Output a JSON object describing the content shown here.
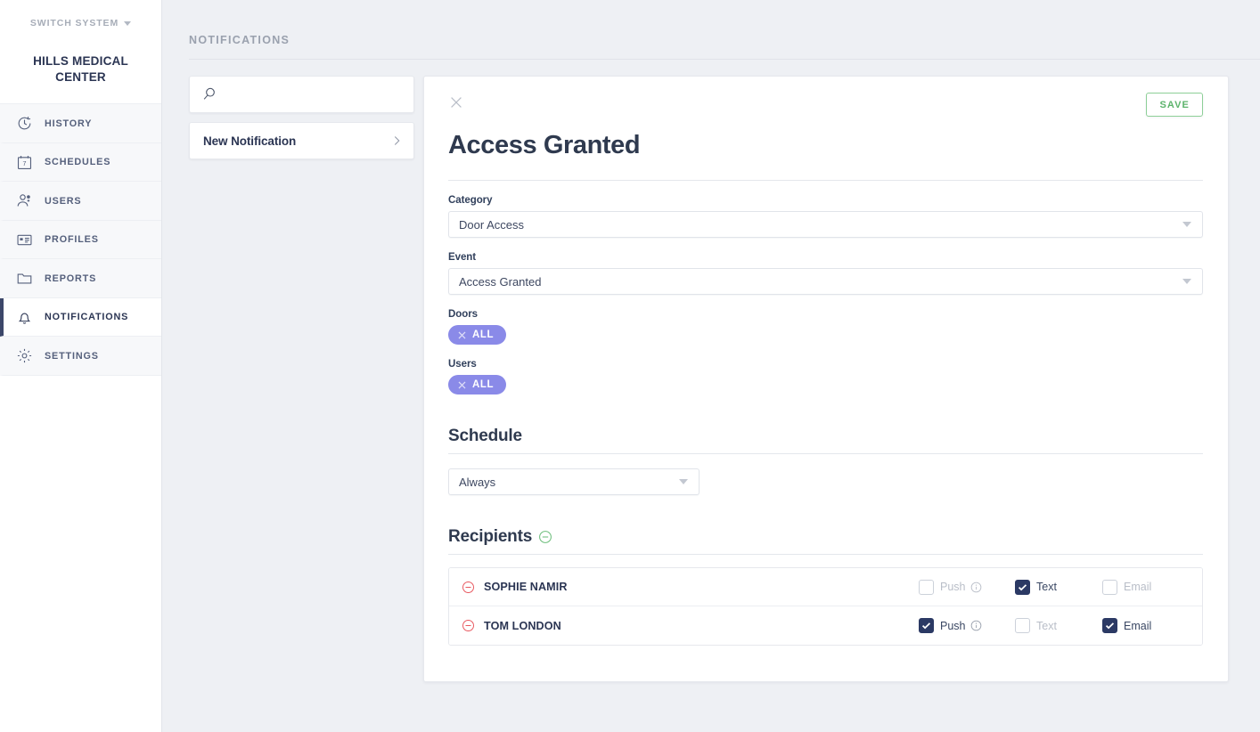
{
  "sidebar": {
    "switch_system": "SWITCH SYSTEM",
    "org_name": "HILLS MEDICAL CENTER",
    "items": [
      {
        "label": "HISTORY",
        "icon": "clock-icon",
        "active": false
      },
      {
        "label": "SCHEDULES",
        "icon": "calendar-icon",
        "active": false
      },
      {
        "label": "USERS",
        "icon": "users-icon",
        "active": false
      },
      {
        "label": "PROFILES",
        "icon": "id-card-icon",
        "active": false
      },
      {
        "label": "REPORTS",
        "icon": "folder-icon",
        "active": false
      },
      {
        "label": "NOTIFICATIONS",
        "icon": "bell-icon",
        "active": true
      },
      {
        "label": "SETTINGS",
        "icon": "gear-icon",
        "active": false
      }
    ]
  },
  "header": {
    "title": "NOTIFICATIONS"
  },
  "list_panel": {
    "search_placeholder": "",
    "search_value": "",
    "items": [
      {
        "label": "New Notification"
      }
    ]
  },
  "detail": {
    "close_label": "",
    "save_label": "SAVE",
    "title": "Access Granted",
    "fields": [
      {
        "label": "Category",
        "value": "Door Access"
      },
      {
        "label": "Event",
        "value": "Access Granted"
      }
    ],
    "doors": {
      "label": "Doors",
      "chip": "ALL"
    },
    "users": {
      "label": "Users",
      "chip": "ALL"
    },
    "schedule": {
      "title": "Schedule",
      "value": "Always"
    },
    "recipients": {
      "title": "Recipients",
      "rows": [
        {
          "name": "SOPHIE NAMIR",
          "push": {
            "label": "Push",
            "checked": false,
            "muted": true
          },
          "text": {
            "label": "Text",
            "checked": true,
            "muted": false
          },
          "email": {
            "label": "Email",
            "checked": false,
            "muted": true
          }
        },
        {
          "name": "TOM LONDON",
          "push": {
            "label": "Push",
            "checked": true,
            "muted": false
          },
          "text": {
            "label": "Text",
            "checked": false,
            "muted": true
          },
          "email": {
            "label": "Email",
            "checked": true,
            "muted": false
          }
        }
      ]
    }
  },
  "colors": {
    "accent_navy": "#2b3964",
    "chip_purple": "#8a8ae8",
    "save_green": "#5cb36b",
    "remove_red": "#e8585f",
    "add_green": "#6bbd7a",
    "page_bg": "#eef0f4"
  }
}
